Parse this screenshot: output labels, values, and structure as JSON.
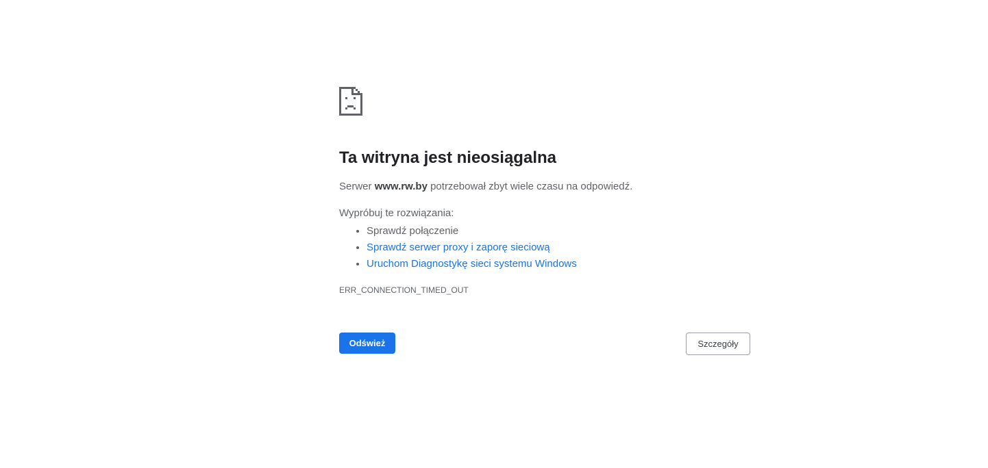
{
  "page": {
    "icon": "sad-page-icon",
    "title": "Ta witryna jest nieosiągalna",
    "summary": {
      "prefix": "Serwer ",
      "host": "www.rw.by",
      "suffix": " potrzebował zbyt wiele czasu na odpowiedź."
    },
    "suggestions_heading": "Wypróbuj te rozwiązania:",
    "suggestions": [
      {
        "label": "Sprawdź połączenie",
        "is_link": false
      },
      {
        "label": "Sprawdź serwer proxy i zaporę sieciową",
        "is_link": true
      },
      {
        "label": "Uruchom Diagnostykę sieci systemu Windows",
        "is_link": true
      }
    ],
    "error_code": "ERR_CONNECTION_TIMED_OUT",
    "reload_button": "Odśwież",
    "details_button": "Szczegóły"
  },
  "colors": {
    "title": "#202124",
    "body_text": "#5f6368",
    "link": "#1a73e8",
    "primary_button": "#1a73e8",
    "secondary_border": "#9aa0a6"
  }
}
